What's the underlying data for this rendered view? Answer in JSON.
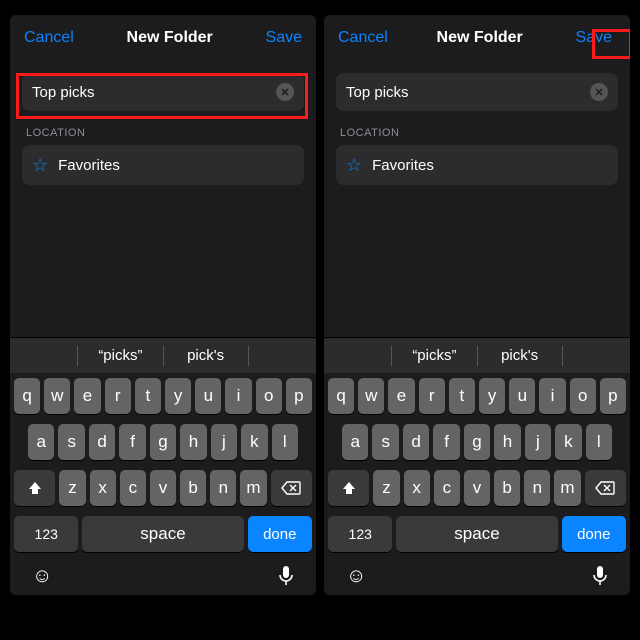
{
  "nav": {
    "cancel": "Cancel",
    "title": "New Folder",
    "save": "Save"
  },
  "input": {
    "value": "Top picks"
  },
  "section": {
    "location_label": "LOCATION",
    "favorites": "Favorites"
  },
  "suggestions": {
    "a": "“picks”",
    "b": "pick's"
  },
  "keys": {
    "r1": [
      "q",
      "w",
      "e",
      "r",
      "t",
      "y",
      "u",
      "i",
      "o",
      "p"
    ],
    "r2": [
      "a",
      "s",
      "d",
      "f",
      "g",
      "h",
      "j",
      "k",
      "l"
    ],
    "r3": [
      "z",
      "x",
      "c",
      "v",
      "b",
      "n",
      "m"
    ],
    "num": "123",
    "space": "space",
    "done": "done"
  }
}
